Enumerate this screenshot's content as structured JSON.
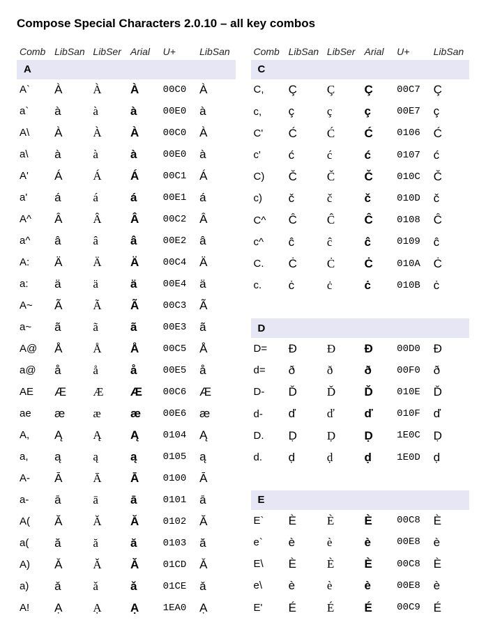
{
  "title": "Compose Special Characters 2.0.10 – all key combos",
  "headers": [
    "Comb",
    "LibSan",
    "LibSer",
    "Arial",
    "U+",
    "LibSan"
  ],
  "left": [
    {
      "group": "A"
    },
    {
      "comb": "A`",
      "ch": "À",
      "code": "00C0"
    },
    {
      "comb": "a`",
      "ch": "à",
      "code": "00E0"
    },
    {
      "comb": "A\\",
      "ch": "À",
      "code": "00C0"
    },
    {
      "comb": "a\\",
      "ch": "à",
      "code": "00E0"
    },
    {
      "comb": "A'",
      "ch": "Á",
      "code": "00C1"
    },
    {
      "comb": "a'",
      "ch": "á",
      "code": "00E1"
    },
    {
      "comb": "A^",
      "ch": "Â",
      "code": "00C2"
    },
    {
      "comb": "a^",
      "ch": "â",
      "code": "00E2"
    },
    {
      "comb": "A:",
      "ch": "Ä",
      "code": "00C4"
    },
    {
      "comb": "a:",
      "ch": "ä",
      "code": "00E4"
    },
    {
      "comb": "A~",
      "ch": "Ã",
      "code": "00C3"
    },
    {
      "comb": "a~",
      "ch": "ã",
      "code": "00E3"
    },
    {
      "comb": "A@",
      "ch": "Å",
      "code": "00C5"
    },
    {
      "comb": "a@",
      "ch": "å",
      "code": "00E5"
    },
    {
      "comb": "AE",
      "ch": "Æ",
      "code": "00C6"
    },
    {
      "comb": "ae",
      "ch": "æ",
      "code": "00E6"
    },
    {
      "comb": "A,",
      "ch": "Ą",
      "code": "0104"
    },
    {
      "comb": "a,",
      "ch": "ą",
      "code": "0105"
    },
    {
      "comb": "A-",
      "ch": "Ā",
      "code": "0100"
    },
    {
      "comb": "a-",
      "ch": "ā",
      "code": "0101"
    },
    {
      "comb": "A(",
      "ch": "Ă",
      "code": "0102"
    },
    {
      "comb": "a(",
      "ch": "ă",
      "code": "0103"
    },
    {
      "comb": "A)",
      "ch": "Ǎ",
      "code": "01CD"
    },
    {
      "comb": "a)",
      "ch": "ǎ",
      "code": "01CE"
    },
    {
      "comb": "A!",
      "ch": "Ạ",
      "code": "1EA0"
    }
  ],
  "right": [
    {
      "group": "C"
    },
    {
      "comb": "C,",
      "ch": "Ç",
      "code": "00C7"
    },
    {
      "comb": "c,",
      "ch": "ç",
      "code": "00E7"
    },
    {
      "comb": "C'",
      "ch": "Ć",
      "code": "0106"
    },
    {
      "comb": "c'",
      "ch": "ć",
      "code": "0107"
    },
    {
      "comb": "C)",
      "ch": "Č",
      "code": "010C"
    },
    {
      "comb": "c)",
      "ch": "č",
      "code": "010D"
    },
    {
      "comb": "C^",
      "ch": "Ĉ",
      "code": "0108"
    },
    {
      "comb": "c^",
      "ch": "ĉ",
      "code": "0109"
    },
    {
      "comb": "C.",
      "ch": "Ċ",
      "code": "010A"
    },
    {
      "comb": "c.",
      "ch": "ċ",
      "code": "010B"
    },
    {
      "spacer": true
    },
    {
      "group": "D"
    },
    {
      "comb": "D=",
      "ch": "Đ",
      "code": "00D0"
    },
    {
      "comb": "d=",
      "ch": "ð",
      "code": "00F0"
    },
    {
      "comb": "D-",
      "ch": "Ď",
      "code": "010E"
    },
    {
      "comb": "d-",
      "ch": "ď",
      "code": "010F"
    },
    {
      "comb": "D.",
      "ch": "Ḍ",
      "code": "1E0C"
    },
    {
      "comb": "d.",
      "ch": "ḍ",
      "code": "1E0D"
    },
    {
      "spacer": true
    },
    {
      "group": "E"
    },
    {
      "comb": "E`",
      "ch": "È",
      "code": "00C8"
    },
    {
      "comb": "e`",
      "ch": "è",
      "code": "00E8"
    },
    {
      "comb": "E\\",
      "ch": "È",
      "code": "00C8"
    },
    {
      "comb": "e\\",
      "ch": "è",
      "code": "00E8"
    },
    {
      "comb": "E'",
      "ch": "É",
      "code": "00C9"
    }
  ]
}
